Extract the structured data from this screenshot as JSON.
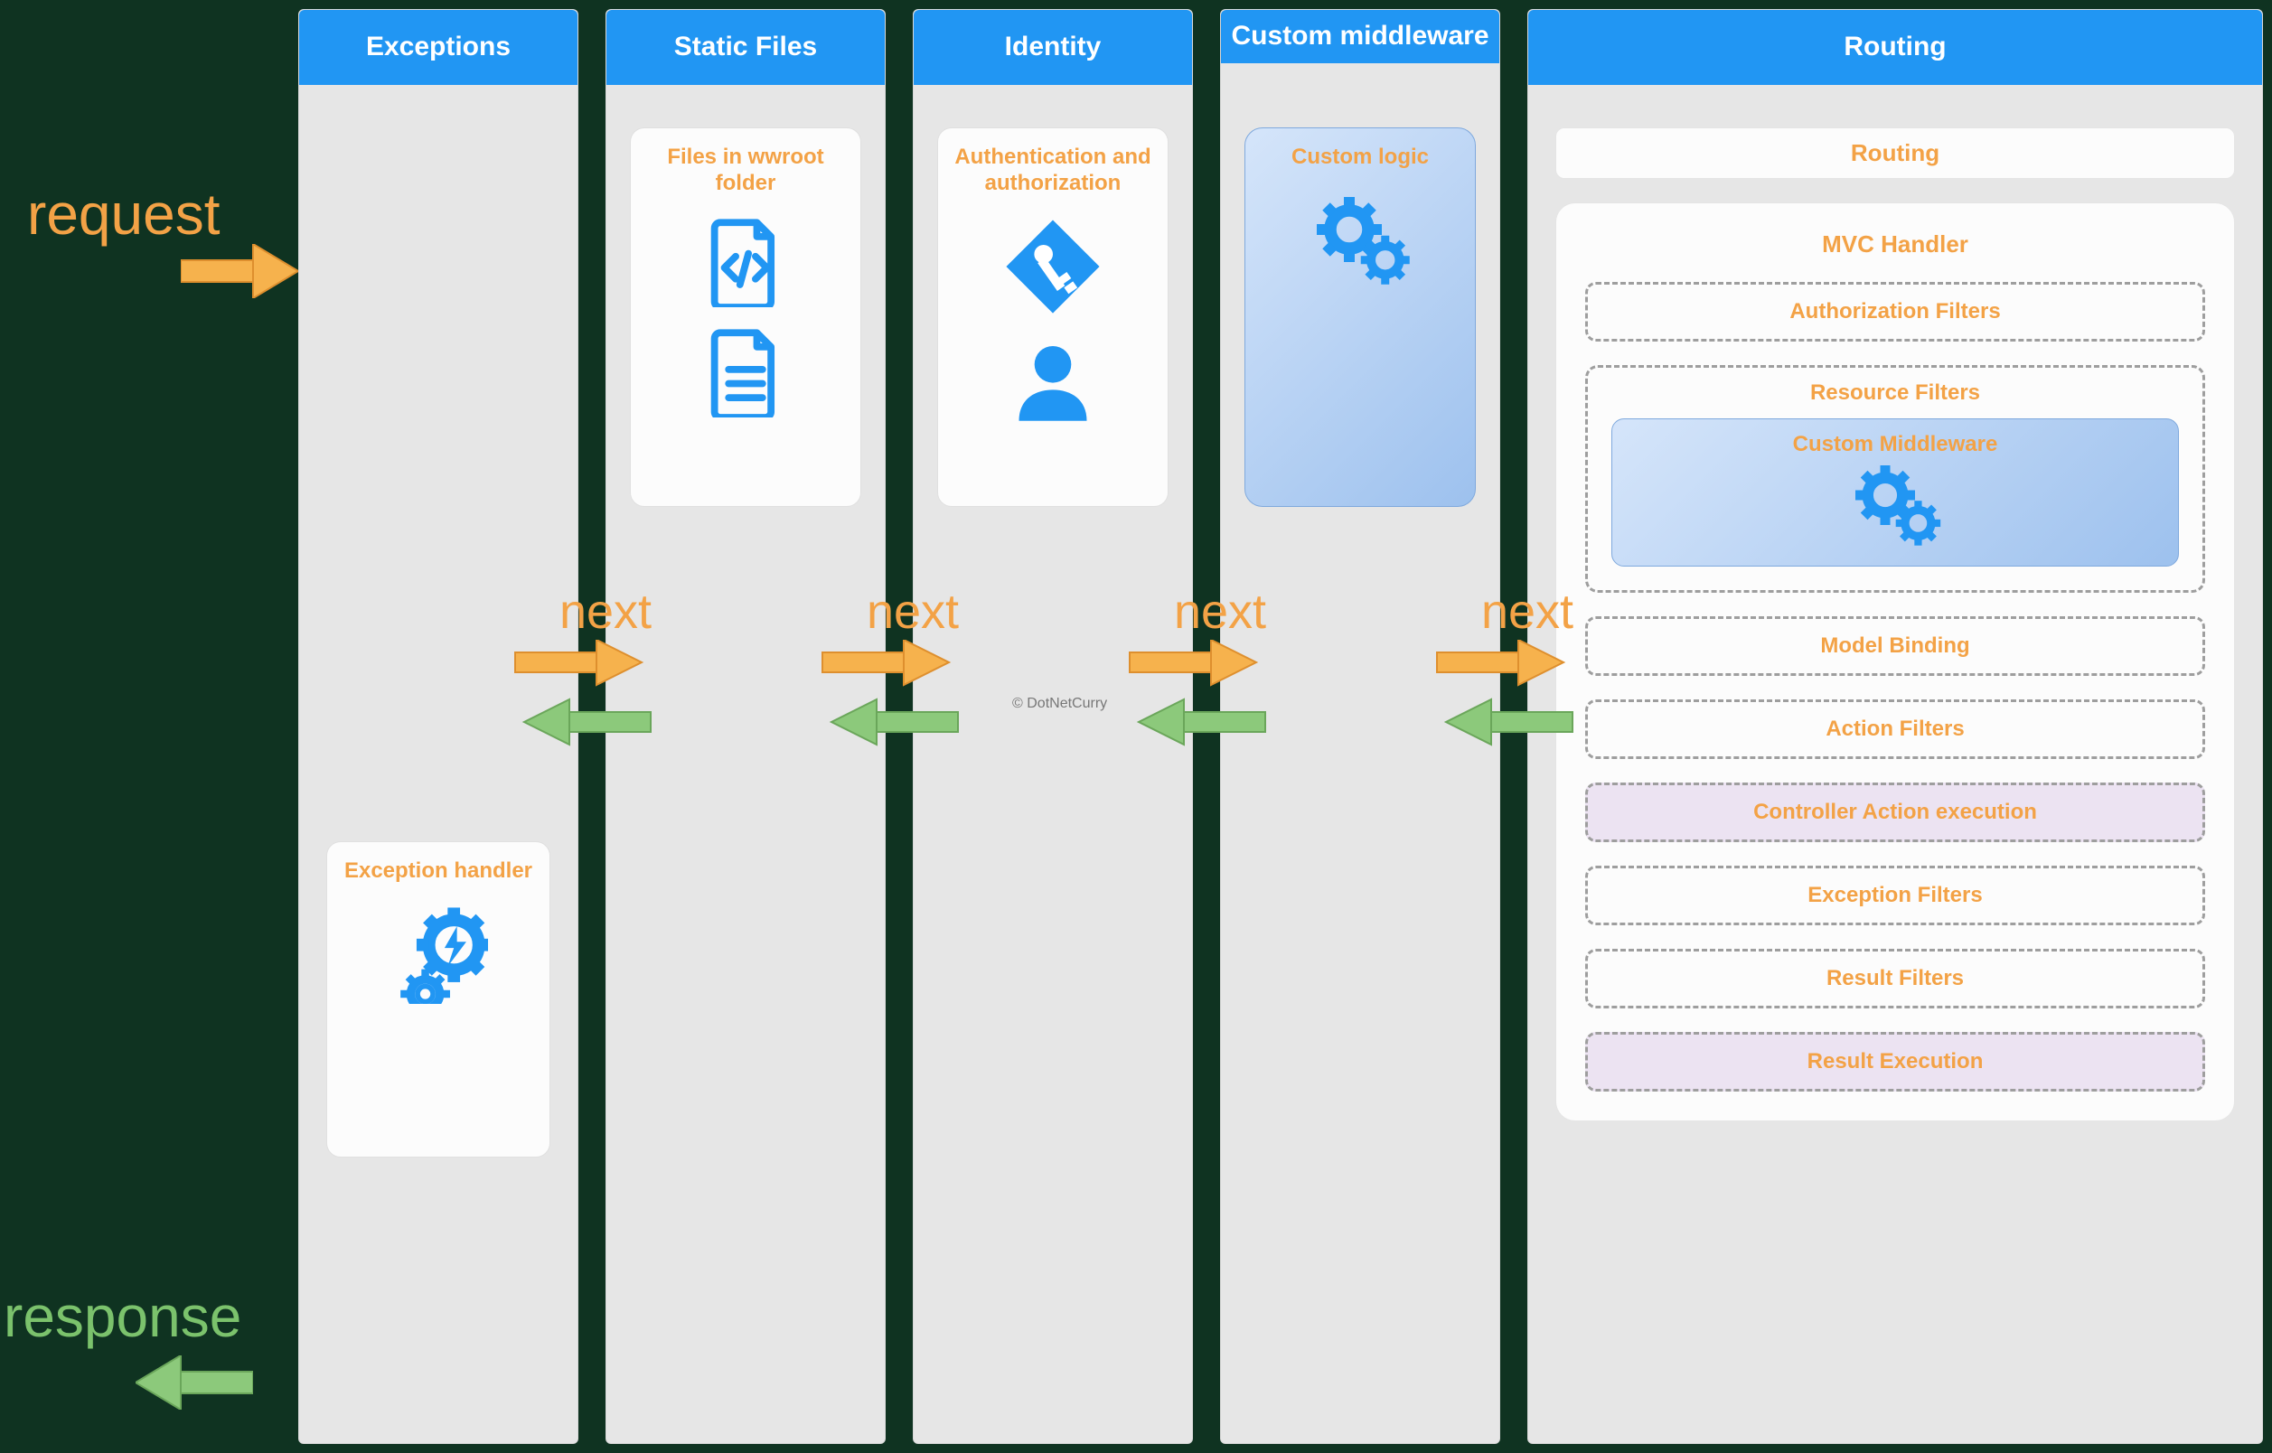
{
  "labels": {
    "request": "request",
    "response": "response",
    "next": "next",
    "watermark": "© DotNetCurry"
  },
  "columns": {
    "exceptions": {
      "title": "Exceptions",
      "card": "Exception handler"
    },
    "static": {
      "title": "Static Files",
      "card": "Files in wwroot folder"
    },
    "identity": {
      "title": "Identity",
      "card": "Authentication and authorization"
    },
    "custom": {
      "title": "Custom middleware",
      "card": "Custom logic"
    },
    "routing": {
      "title": "Routing"
    }
  },
  "routing": {
    "top": "Routing",
    "mvc": "MVC Handler",
    "auth": "Authorization Filters",
    "resource": "Resource Filters",
    "cm": "Custom Middleware",
    "model": "Model Binding",
    "actionFilters": "Action Filters",
    "controllerAction": "Controller Action execution",
    "exception": "Exception Filters",
    "result": "Result Filters",
    "resultExec": "Result Execution"
  },
  "colors": {
    "brandBlue": "#2196f3",
    "accentOrange": "#f3a246",
    "accentGreen": "#7bc26c"
  }
}
